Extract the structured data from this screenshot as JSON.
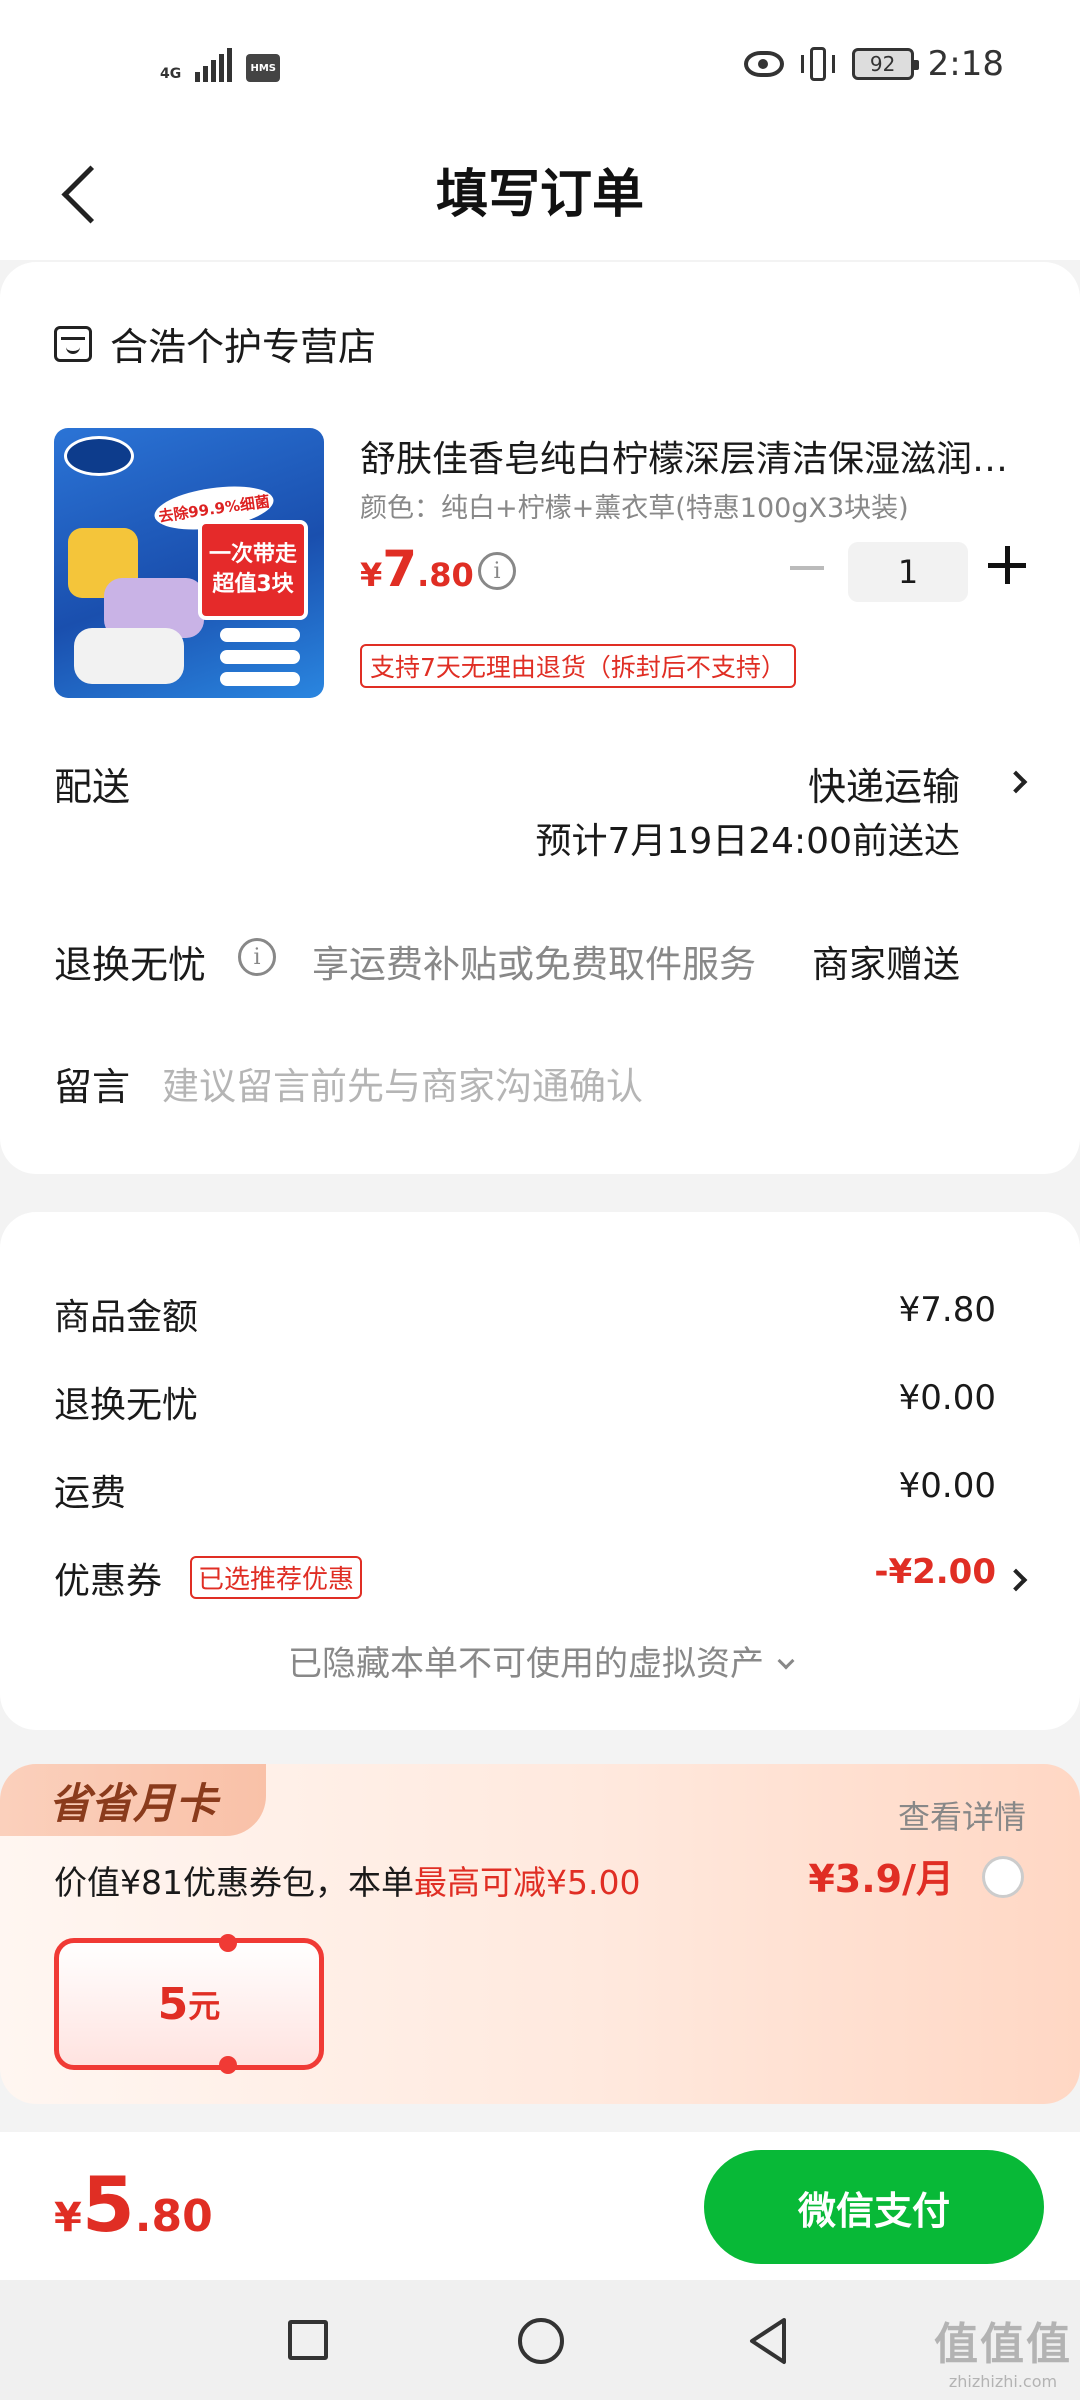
{
  "status_bar": {
    "network": "4G",
    "hms": "HMS",
    "battery": "92",
    "time": "2:18"
  },
  "header": {
    "title": "填写订单"
  },
  "order": {
    "shop_name": "合浩个护专营店",
    "product": {
      "name": "舒肤佳香皂纯白柠檬深层清洁保湿滋润香皂",
      "spec": "颜色：纯白+柠檬+薰衣草(特惠100gX3块装)",
      "price_currency": "¥",
      "price_int": "7",
      "price_dec": ".80",
      "quantity": "1",
      "return_policy": "支持7天无理由退货（拆封后不支持）",
      "image_texts": {
        "badge": "去除99.9%细菌",
        "promo_line1": "一次带走",
        "promo_line2": "超值3块"
      }
    },
    "delivery": {
      "label": "配送",
      "method": "快递运输",
      "eta": "预计7月19日24:00前送达"
    },
    "worry_free": {
      "label": "退换无忧",
      "desc": "享运费补贴或免费取件服务",
      "value": "商家赠送"
    },
    "message": {
      "label": "留言",
      "placeholder": "建议留言前先与商家沟通确认"
    }
  },
  "summary": {
    "goods_label": "商品金额",
    "goods_value": "¥7.80",
    "worry_label": "退换无忧",
    "worry_value": "¥0.00",
    "shipping_label": "运费",
    "shipping_value": "¥0.00",
    "coupon_label": "优惠券",
    "coupon_tag": "已选推荐优惠",
    "coupon_value": "-¥2.00",
    "hidden_assets": "已隐藏本单不可使用的虚拟资产"
  },
  "monthly_card": {
    "title": "省省月卡",
    "detail_link": "查看详情",
    "desc_prefix": "价值¥81优惠券包，本单",
    "desc_highlight": "最高可减¥5.00",
    "price": "¥3.9/月",
    "ticket_amount": "5",
    "ticket_unit": "元"
  },
  "pay_bar": {
    "currency": "¥",
    "total_int": "5",
    "total_dec": ".80",
    "pay_button": "微信支付"
  },
  "watermark": {
    "line1": "值值值",
    "line2": "zhizhizhi.com"
  },
  "colors": {
    "accent_red": "#e02e24",
    "pay_green": "#08b937"
  }
}
